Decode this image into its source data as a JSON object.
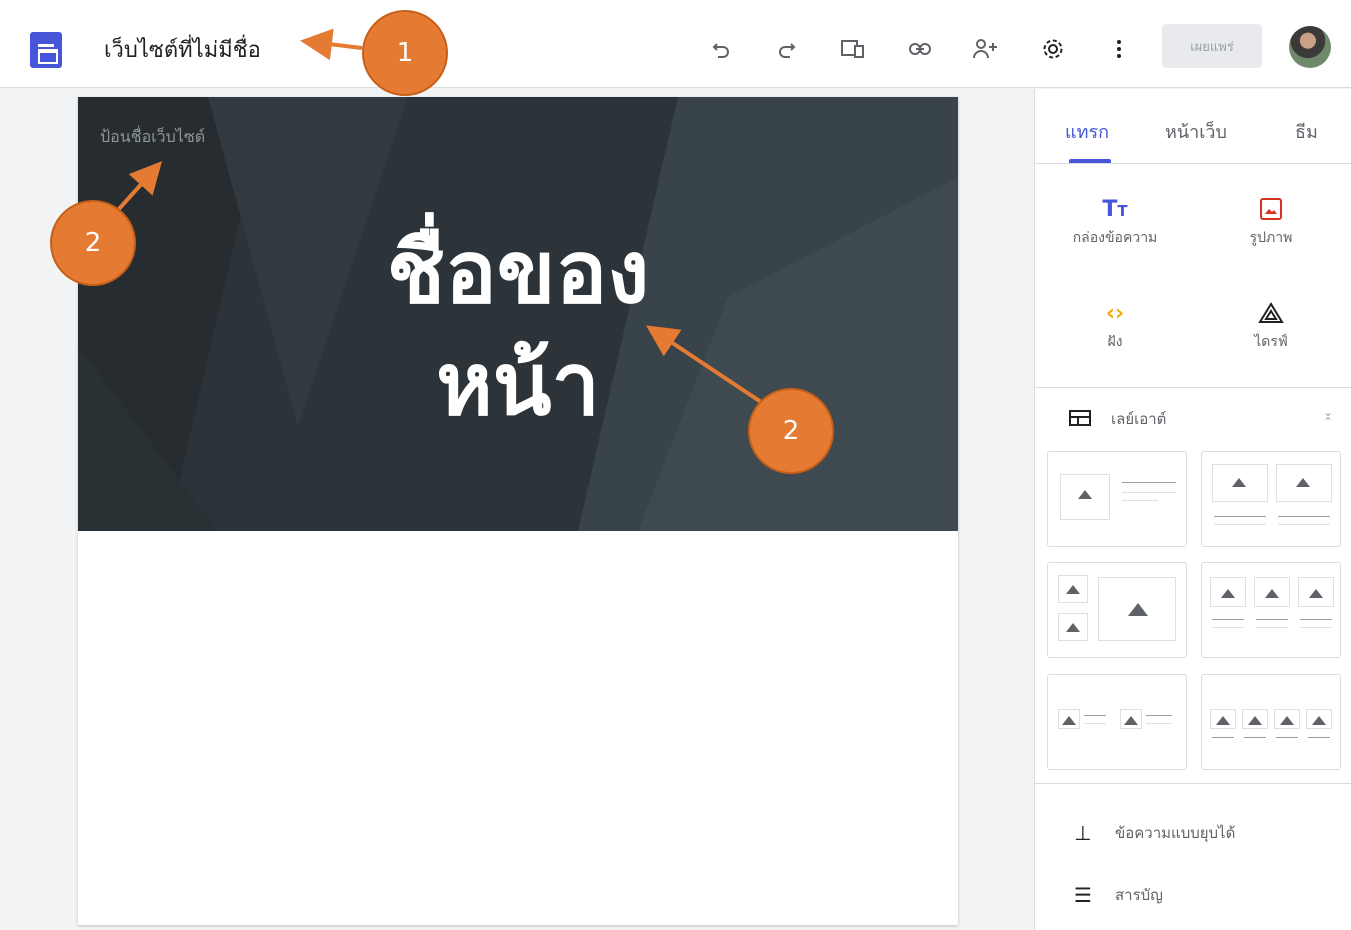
{
  "topbar": {
    "doc_title": "เว็บไซต์ที่ไม่มีชื่อ",
    "icons": [
      "undo-icon",
      "redo-icon",
      "preview-icon",
      "link-icon",
      "share-icon",
      "settings-icon",
      "more-icon"
    ],
    "publish_label": "เผยแพร่"
  },
  "editor": {
    "site_name_placeholder": "ป้อนชื่อเว็บไซต์",
    "page_title_line1": "ชื่อของ",
    "page_title_line2": "หน้า"
  },
  "panel": {
    "tabs": [
      {
        "label": "แทรก",
        "active": true
      },
      {
        "label": "หน้าเว็บ",
        "active": false
      },
      {
        "label": "ธีม",
        "active": false
      }
    ],
    "insert_items": [
      {
        "label": "กล่องข้อความ",
        "icon": "text-box-icon",
        "color": "#4557d8"
      },
      {
        "label": "รูปภาพ",
        "icon": "image-icon",
        "color": "#d93025"
      },
      {
        "label": "ฝัง",
        "icon": "embed-icon",
        "color": "#f9ab00"
      },
      {
        "label": "ไดรฟ์",
        "icon": "drive-icon",
        "color": "#202124"
      }
    ],
    "layout_label": "เลย์เอาต์",
    "bottom_items": [
      {
        "label": "ข้อความแบบยุบได้",
        "icon": "collapsible-text-icon"
      },
      {
        "label": "สารบัญ",
        "icon": "table-of-contents-icon"
      }
    ]
  },
  "annotations": {
    "callout_1": "1",
    "callout_2a": "2",
    "callout_2b": "2",
    "color": "#e57b33"
  }
}
